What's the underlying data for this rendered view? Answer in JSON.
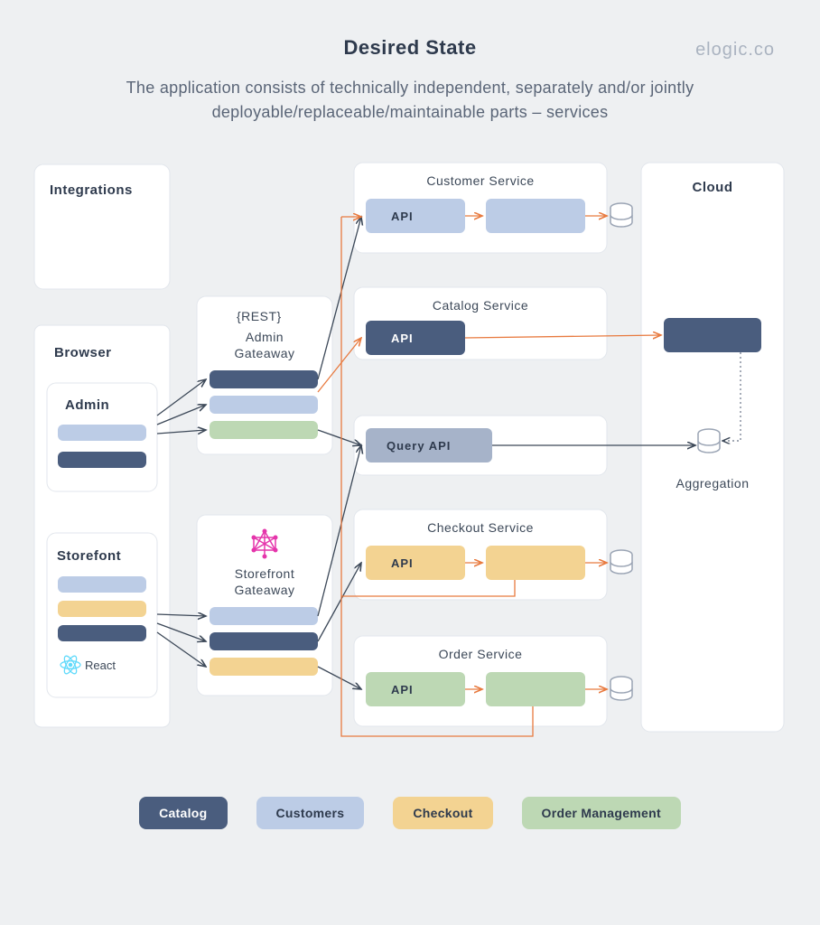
{
  "header": {
    "title": "Desired State",
    "brand": "elogic.co",
    "subtitle": "The application consists of technically independent, separately and/or jointly deployable/replaceable/maintainable parts – services"
  },
  "boxes": {
    "integrations": "Integrations",
    "browser": "Browser",
    "admin": "Admin",
    "storefront": "Storefont",
    "react_label": "React",
    "rest": "{REST}",
    "admin_gateway": "Admin Gateaway",
    "storefront_gateway": "Storefront Gateaway",
    "cloud": "Cloud",
    "aggregation": "Aggregation"
  },
  "services": {
    "customer": {
      "title": "Customer Service",
      "api": "API"
    },
    "catalog": {
      "title": "Catalog Service",
      "api": "API"
    },
    "query": {
      "api": "Query API"
    },
    "checkout": {
      "title": "Checkout Service",
      "api": "API"
    },
    "order": {
      "title": "Order Service",
      "api": "API"
    }
  },
  "legend": {
    "catalog": "Catalog",
    "customers": "Customers",
    "checkout": "Checkout",
    "order": "Order Management"
  },
  "colors": {
    "catalog": "#4a5d7e",
    "customers": "#bccce6",
    "checkout": "#f3d392",
    "order": "#bdd8b4",
    "queryapi": "#a6b3c9",
    "arrow_orange": "#e87a3f",
    "arrow_gray": "#3c4858"
  }
}
